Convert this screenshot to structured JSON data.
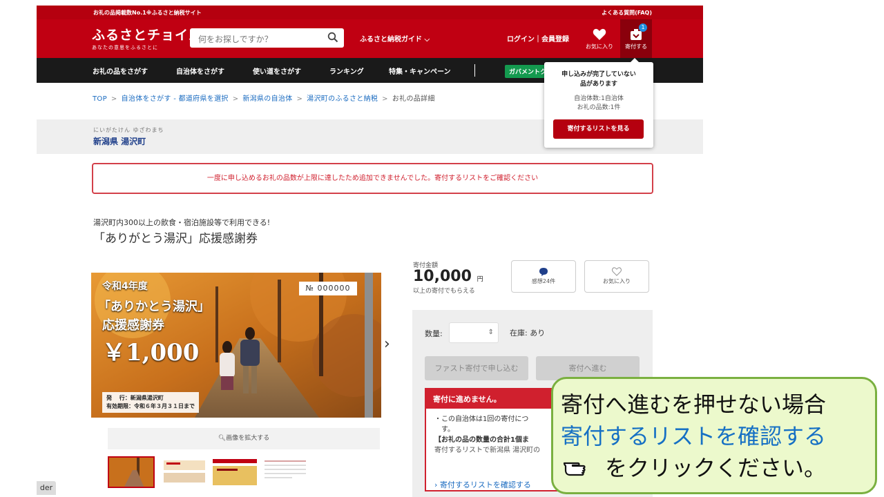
{
  "topbar": {
    "left": "お礼の品掲載数No.1※ふるさと納税サイト",
    "right": "よくある質問(FAQ)"
  },
  "header": {
    "logo_title": "ふるさとチョイス",
    "logo_sub": "あなたの意思をふるさとに",
    "search_placeholder": "何をお探しですか？",
    "guide": "ふるさと納税ガイド",
    "login": "ログイン｜会員登録",
    "fav": "お気に入り",
    "donate": "寄付する",
    "donate_count": "1"
  },
  "nav": [
    "お礼の品をさがす",
    "自治体をさがす",
    "使い道をさがす",
    "ランキング",
    "特集・キャンペーン"
  ],
  "nav_gov": "ガバメントク",
  "breadcrumb": [
    "TOP",
    "自治体をさがす - 都道府県を選択",
    "新潟県の自治体",
    "湯沢町のふるさと納税",
    "お礼の品詳細"
  ],
  "municipality": {
    "kana": "にいがたけん ゆざわまち",
    "name": "新潟県 湯沢町"
  },
  "alert": "一度に申し込めるお礼の品数が上限に達したため追加できませんでした。寄付するリストをご確認ください",
  "product": {
    "subtitle": "湯沢町内300以上の飲食・宿泊施設等で利用できる!",
    "title": "「ありがとう湯沢」応援感謝券"
  },
  "image": {
    "year": "令和4年度",
    "line1": "「ありかとう湯沢」",
    "line2": "応援感謝券",
    "price": "￥1,000",
    "number": "№ 000000",
    "issuer": "発　 行：新潟県湯沢町",
    "expiry": "有効期限：令和６年３月３１日まで",
    "zoom": "画像を拡大する"
  },
  "donation": {
    "label": "寄付金額",
    "amount": "10,000",
    "unit": "円",
    "note": "以上の寄付でもらえる"
  },
  "review_btn": "感想24件",
  "fav_btn": "お気に入り",
  "order": {
    "qty_label": "数量:",
    "stock": "在庫: あり",
    "fast_btn": "ファスト寄付で申し込む",
    "next_btn": "寄付へ進む",
    "error_title": "寄付に進めません。",
    "error_l1": "・この自治体は1回の寄付につ",
    "error_l2": "す。",
    "error_l3": "【お礼の品の数量の合計1個ま",
    "error_l4": "寄付するリストで新潟県 湯沢町の",
    "error_link": "寄付するリストを確認する"
  },
  "popup": {
    "h1": "申し込みが完了していない",
    "h2": "品があります",
    "c1": "自治体数:1自治体",
    "c2": "お礼の品数:1件",
    "btn": "寄付するリストを見る"
  },
  "edge_label": "der",
  "callout": {
    "l1": "寄付へ進むを押せない場合",
    "l2": "寄付するリストを確認する",
    "l3": "をクリックください。"
  },
  "colors": {
    "brand": "#c00012",
    "link": "#1670c4",
    "callout_bg": "#ecf9cc",
    "callout_border": "#7ab040"
  }
}
